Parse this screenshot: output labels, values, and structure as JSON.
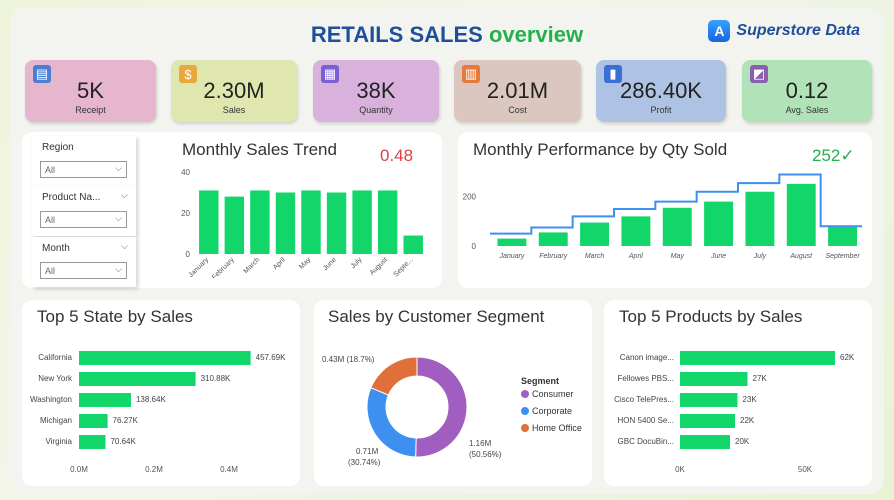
{
  "header": {
    "title_a": "RETAILS SALES",
    "title_b": "overview",
    "brand": "Superstore Data",
    "brand_logo": "A"
  },
  "kpis": [
    {
      "value": "5K",
      "label": "Receipt",
      "color": "#e6b6cf",
      "icon": "receipt-icon"
    },
    {
      "value": "2.30M",
      "label": "Sales",
      "color": "#dfe6ae",
      "icon": "sales-icon"
    },
    {
      "value": "38K",
      "label": "Quantity",
      "color": "#d8b2dc",
      "icon": "quantity-icon"
    },
    {
      "value": "2.01M",
      "label": "Cost",
      "color": "#dbc6c0",
      "icon": "cost-icon"
    },
    {
      "value": "286.40K",
      "label": "Profit",
      "color": "#aec3e3",
      "icon": "profit-icon"
    },
    {
      "value": "0.12",
      "label": "Avg. Sales",
      "color": "#b2e3b8",
      "icon": "avg-sales-icon"
    }
  ],
  "slicers": [
    {
      "label": "Region",
      "value": "All"
    },
    {
      "label": "Product Na...",
      "value": "All"
    },
    {
      "label": "Month",
      "value": "All"
    }
  ],
  "monthly_sales": {
    "title": "Monthly Sales  Trend",
    "kpi": "0.48",
    "kpi_color": "#e0404a",
    "chart_data": {
      "type": "bar",
      "categories": [
        "January",
        "February",
        "March",
        "April",
        "May",
        "June",
        "July",
        "August",
        "Septe..."
      ],
      "values": [
        31,
        28,
        31,
        30,
        31,
        30,
        31,
        31,
        9
      ],
      "ylim": [
        0,
        40
      ],
      "yticks": [
        "0",
        "20",
        "40"
      ],
      "color": "#12d66a"
    }
  },
  "qty_perf": {
    "title": "Monthly Performance by Qty Sold",
    "kpi": "252✓",
    "kpi_color": "#22b14c",
    "chart_data": {
      "type": "bar",
      "categories": [
        "January",
        "February",
        "March",
        "April",
        "May",
        "June",
        "July",
        "August",
        "September"
      ],
      "values": [
        30,
        55,
        95,
        120,
        155,
        180,
        220,
        252,
        80
      ],
      "line": [
        50,
        75,
        120,
        150,
        180,
        220,
        255,
        290,
        80
      ],
      "ylim": [
        0,
        300
      ],
      "yticks": [
        "0",
        "200"
      ],
      "bar_color": "#12d66a",
      "line_color": "#3d8ff0"
    }
  },
  "top_states": {
    "title": "Top 5 State by Sales",
    "chart_data": {
      "type": "bar",
      "orientation": "horizontal",
      "categories": [
        "California",
        "New York",
        "Washington",
        "Michigan",
        "Virginia"
      ],
      "values": [
        457.69,
        310.88,
        138.64,
        76.27,
        70.64
      ],
      "labels": [
        "457.69K",
        "310.88K",
        "138.64K",
        "76.27K",
        "70.64K"
      ],
      "xlim": [
        0,
        400
      ],
      "xticks": [
        "0.0M",
        "0.2M",
        "0.4M"
      ],
      "color": "#12d66a"
    }
  },
  "segment": {
    "title": "Sales by Customer Segment",
    "chart_data": {
      "type": "pie",
      "donut": true,
      "legend_title": "Segment",
      "slices": [
        {
          "name": "Consumer",
          "value": 1.16,
          "pct": 50.56,
          "color": "#a05ec1"
        },
        {
          "name": "Corporate",
          "value": 0.71,
          "pct": 30.74,
          "color": "#3d8ff0"
        },
        {
          "name": "Home Office",
          "value": 0.43,
          "pct": 18.7,
          "color": "#e0703a"
        }
      ],
      "labels": {
        "consumer_a": "1.16M",
        "consumer_b": "(50.56%)",
        "corporate_a": "0.71M",
        "corporate_b": "(30.74%)",
        "home": "0.43M (18.7%)"
      }
    }
  },
  "top_products": {
    "title": "Top 5 Products by Sales",
    "chart_data": {
      "type": "bar",
      "orientation": "horizontal",
      "categories": [
        "Canon image...",
        "Fellowes PBS...",
        "Cisco TelePres...",
        "HON 5400 Se...",
        "GBC DocuBin..."
      ],
      "values": [
        62,
        27,
        23,
        22,
        20
      ],
      "labels": [
        "62K",
        "27K",
        "23K",
        "22K",
        "20K"
      ],
      "xlim": [
        0,
        50
      ],
      "xticks": [
        "0K",
        "50K"
      ],
      "color": "#12d66a"
    }
  }
}
